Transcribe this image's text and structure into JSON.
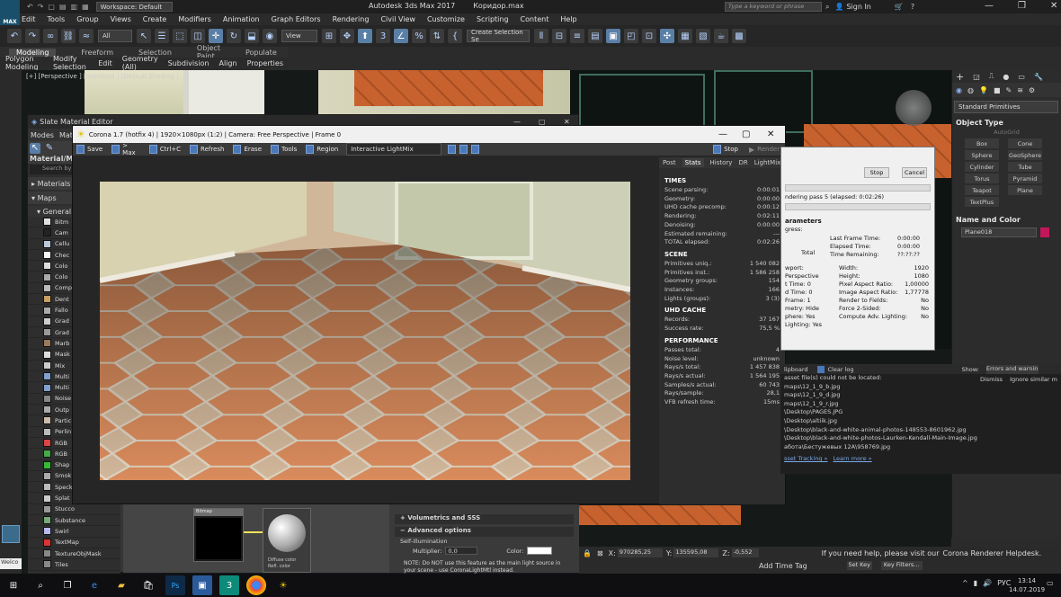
{
  "app": {
    "title": "Autodesk 3ds Max 2017",
    "file": "Коридор.max",
    "workspace": "Workspace: Default",
    "search_placeholder": "Type a keyword or phrase",
    "sign_in": "Sign In",
    "logo": "MAX"
  },
  "menu": [
    "Edit",
    "Tools",
    "Group",
    "Views",
    "Create",
    "Modifiers",
    "Animation",
    "Graph Editors",
    "Rendering",
    "Civil View",
    "Customize",
    "Scripting",
    "Content",
    "Help"
  ],
  "toolbar": {
    "selection_filter": "All",
    "ref_coord": "View",
    "named_selection": "Create Selection Se"
  },
  "ribbon": {
    "tabs": [
      "Modeling",
      "Freeform",
      "Selection",
      "Object Paint",
      "Populate"
    ],
    "subtabs": [
      "Polygon Modeling",
      "Modify Selection",
      "Edit",
      "Geometry (All)",
      "Subdivision",
      "Align",
      "Properties"
    ]
  },
  "viewport": {
    "label": "[+] [Perspective ] [Standard ] [Default Shading ]"
  },
  "command_panel": {
    "dropdown": "Standard Primitives",
    "object_type_header": "Object Type",
    "autogrid": "AutoGrid",
    "buttons": [
      "Box",
      "Cone",
      "Sphere",
      "GeoSphere",
      "Cylinder",
      "Tube",
      "Torus",
      "Pyramid",
      "Teapot",
      "Plane",
      "TextPlus"
    ],
    "name_color_header": "Name and Color",
    "object_name": "Plane018"
  },
  "slate": {
    "title": "Slate Material Editor",
    "menu": [
      "Modes",
      "Mate"
    ],
    "browser_header": "Material/Ma",
    "search": "Search by",
    "sections": [
      "Materials",
      "Maps",
      "General"
    ],
    "items": [
      "Bitm",
      "Cam",
      "Cellu",
      "Chec",
      "Colo",
      "Colo",
      "Comp",
      "Dent",
      "Fallo",
      "Grad",
      "Grad",
      "Marb",
      "Mask",
      "Mix",
      "Multi",
      "Multi",
      "Noise",
      "Outp",
      "Partic",
      "Perlin",
      "RGB",
      "RGB",
      "Shap",
      "Smok",
      "Speck",
      "Splat",
      "Stucco",
      "Substance",
      "Swirl",
      "TextMap",
      "TextureObjMask",
      "Tiles"
    ],
    "node_label": "Bitmap",
    "node_slots": [
      "Diffuse color",
      "Refl. color"
    ],
    "panel": {
      "volumetrics": "Volumetrics and SSS",
      "advanced": "Advanced options",
      "self_illum": "Self-illumination",
      "multiplier_label": "Multiplier:",
      "multiplier_value": "0,0",
      "color_label": "Color:",
      "note": "NOTE: Do NOT use this feature as the main light source in your scene - use CoronaLightMtl instead."
    }
  },
  "vfb": {
    "title": "Corona 1.7 (hotfix 4) | 1920×1080px (1:2) | Camera: Free Perspective | Frame 0",
    "tools": [
      "Save",
      "> Max",
      "Ctrl+C",
      "Refresh",
      "Erase",
      "Tools",
      "Region"
    ],
    "lightmix": "Interactive LightMix",
    "stop": "Stop",
    "render": "Render",
    "tabs": [
      "Post",
      "Stats",
      "History",
      "DR",
      "LightMix"
    ],
    "active_tab": "Stats",
    "sections": [
      {
        "title": "TIMES",
        "rows": [
          [
            "Scene parsing:",
            "0:00:01"
          ],
          [
            "Geometry:",
            "0:00:00"
          ],
          [
            "UHD cache precomp:",
            "0:00:12"
          ],
          [
            "Rendering:",
            "0:02:11"
          ],
          [
            "Denoising:",
            "0:00:00"
          ],
          [
            "Estimated remaining:",
            "---"
          ],
          [
            "TOTAL elapsed:",
            "0:02:26"
          ]
        ]
      },
      {
        "title": "SCENE",
        "rows": [
          [
            "Primitives uniq.:",
            "1 540 082"
          ],
          [
            "Primitives inst.:",
            "1 586 258"
          ],
          [
            "Geometry groups:",
            "154"
          ],
          [
            "Instances:",
            "166"
          ],
          [
            "Lights (groups):",
            "3 (3)"
          ]
        ]
      },
      {
        "title": "UHD CACHE",
        "rows": [
          [
            "Records:",
            "37 167"
          ],
          [
            "Success rate:",
            "75,5 %"
          ]
        ]
      },
      {
        "title": "PERFORMANCE",
        "rows": [
          [
            "Passes total:",
            "4"
          ],
          [
            "Noise level:",
            "unknown"
          ],
          [
            "Rays/s total:",
            "1 457 838"
          ],
          [
            "Rays/s actual:",
            "1 564 195"
          ],
          [
            "Samples/s actual:",
            "60 743"
          ],
          [
            "Rays/sample:",
            "28,1"
          ],
          [
            "VFB refresh time:",
            "15ms"
          ]
        ]
      }
    ]
  },
  "progress": {
    "stop": "Stop",
    "cancel": "Cancel",
    "pass_text": "ndering pass 5 (elapsed: 0:02:26)",
    "params_header": "arameters",
    "progress_label": "gress:",
    "total": "Total",
    "times": [
      [
        "Last Frame Time:",
        "0:00:00"
      ],
      [
        "Elapsed Time:",
        "0:00:00"
      ],
      [
        "Time Remaining:",
        "??:??:??"
      ]
    ],
    "left_col": [
      "wport: Perspective",
      "t Time: 0",
      "d Time: 0",
      "Frame: 1",
      "metry: Hide",
      "phere: Yes",
      "Lighting: Yes"
    ],
    "right_col": [
      [
        "Width:",
        "1920"
      ],
      [
        "Height:",
        "1080"
      ],
      [
        "Pixel Aspect Ratio:",
        "1,00000"
      ],
      [
        "Image Aspect Ratio:",
        "1,77778"
      ],
      [
        "Render to Fields:",
        "No"
      ],
      [
        "Force 2-Sided:",
        "No"
      ],
      [
        "Compute Adv. Lighting:",
        "No"
      ]
    ]
  },
  "log": {
    "clipboard": "lipboard",
    "clear": "Clear log",
    "show_label": "Show:",
    "show_value": "Errors and warnin",
    "dismiss": "Dismiss",
    "ignore": "Ignore similar m",
    "lines": [
      "asset file(s) could not be located:",
      "maps\\12_1_9_b.jpg",
      "maps\\12_1_9_d.jpg",
      "maps\\12_1_9_r.jpg",
      "\\Desktop\\PAGES.JPG",
      "\\Desktop\\altiik.jpg",
      "\\Desktop\\black-and-white-animal-photos-148553-8601962.jpg",
      "\\Desktop\\black-and-white-photos-Laurken-Kendall-Main-Image.jpg",
      "абота\\Бестужевых 12А\\958769.jpg"
    ],
    "asset_link": "sset Tracking »",
    "learn_link": "Learn more »",
    "help_text": "If you need help, please visit our",
    "help_link": "Corona Renderer Helpdesk."
  },
  "statusbar": {
    "x_label": "X:",
    "x_value": "970285,25",
    "y_label": "Y:",
    "y_value": "135595,08",
    "z_label": "Z:",
    "z_value": "-0,552",
    "add_time_tag": "Add Time Tag",
    "set_key": "Set Key",
    "key_filters": "Key Filters..."
  },
  "left_mini": "Welco",
  "taskbar": {
    "lang": "РУС",
    "time": "13:14",
    "date": "14.07.2019"
  },
  "colors": {
    "accent": "#5a7fa6",
    "object_color": "#c2185b",
    "vfb_title_bg": "#f0f0f0"
  }
}
